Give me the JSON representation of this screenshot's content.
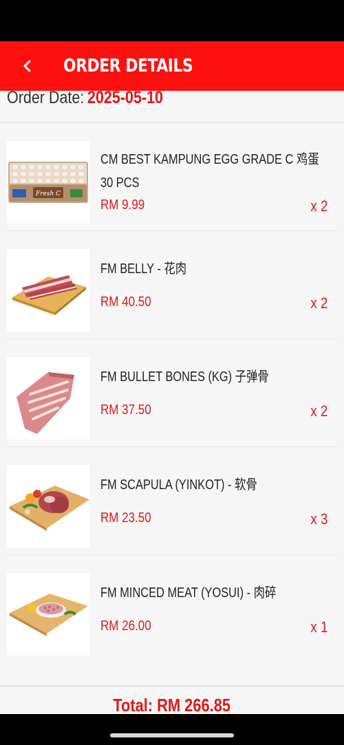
{
  "header": {
    "title": "ORDER DETAILS"
  },
  "order": {
    "date_label": "Order Date:",
    "date_value": "2025-05-10",
    "total_text": "Total: RM 266.85"
  },
  "items": [
    {
      "name": "CM BEST KAMPUNG EGG GRADE C 鸡蛋 30 PCS",
      "price": "RM 9.99",
      "qty": "x 2",
      "image_label": "Fresh C"
    },
    {
      "name": "FM BELLY - 花肉",
      "price": "RM 40.50",
      "qty": "x 2"
    },
    {
      "name": "FM BULLET BONES (KG) 子弹骨",
      "price": "RM 37.50",
      "qty": "x 2"
    },
    {
      "name": "FM SCAPULA (YINKOT) - 软骨",
      "price": "RM 23.50",
      "qty": "x 3"
    },
    {
      "name": "FM MINCED MEAT (YOSUI) - 肉碎",
      "price": "RM 26.00",
      "qty": "x 1"
    }
  ],
  "colors": {
    "accent": "#ff1010",
    "price": "#e01818"
  },
  "icons": {
    "back": "chevron-left-icon"
  }
}
